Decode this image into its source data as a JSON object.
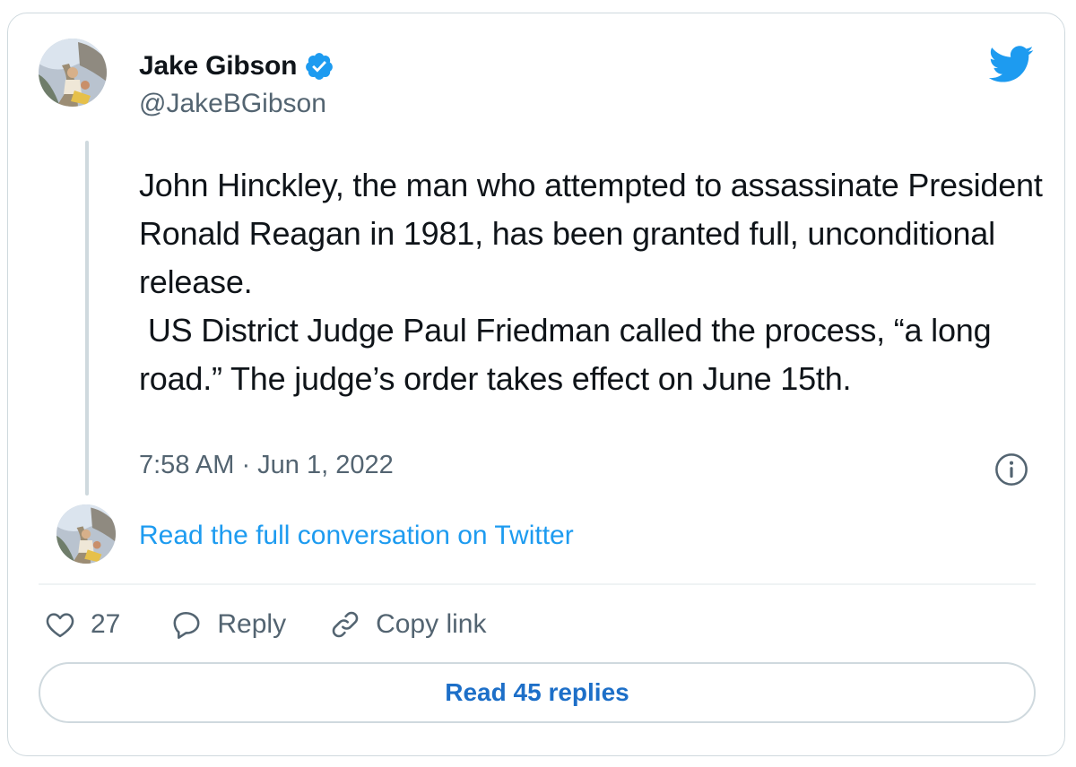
{
  "author": {
    "name": "Jake Gibson",
    "handle": "@JakeBGibson",
    "verified": true
  },
  "tweet": {
    "text": "John Hinckley, the man who attempted to assassinate President Ronald Reagan in 1981, has been granted full, unconditional release.\n US District Judge Paul Friedman called the process, “a long road.” The judge’s order takes effect on June 15th.",
    "timestamp": "7:58 AM · Jun 1, 2022"
  },
  "conversation_link": "Read the full conversation on Twitter",
  "actions": {
    "like_count": "27",
    "reply_label": "Reply",
    "copy_link_label": "Copy link"
  },
  "read_replies_label": "Read 45 replies",
  "icons": {
    "brand": "twitter-bird-icon",
    "verified": "verified-badge-icon",
    "info": "info-icon",
    "like": "heart-icon",
    "reply": "speech-bubble-icon",
    "copy": "link-icon"
  },
  "colors": {
    "twitter_blue": "#1d9bf0",
    "text_primary": "#0f1419",
    "text_secondary": "#536471",
    "border": "#cfd9de",
    "replies_button_text": "#1d6fc8"
  }
}
